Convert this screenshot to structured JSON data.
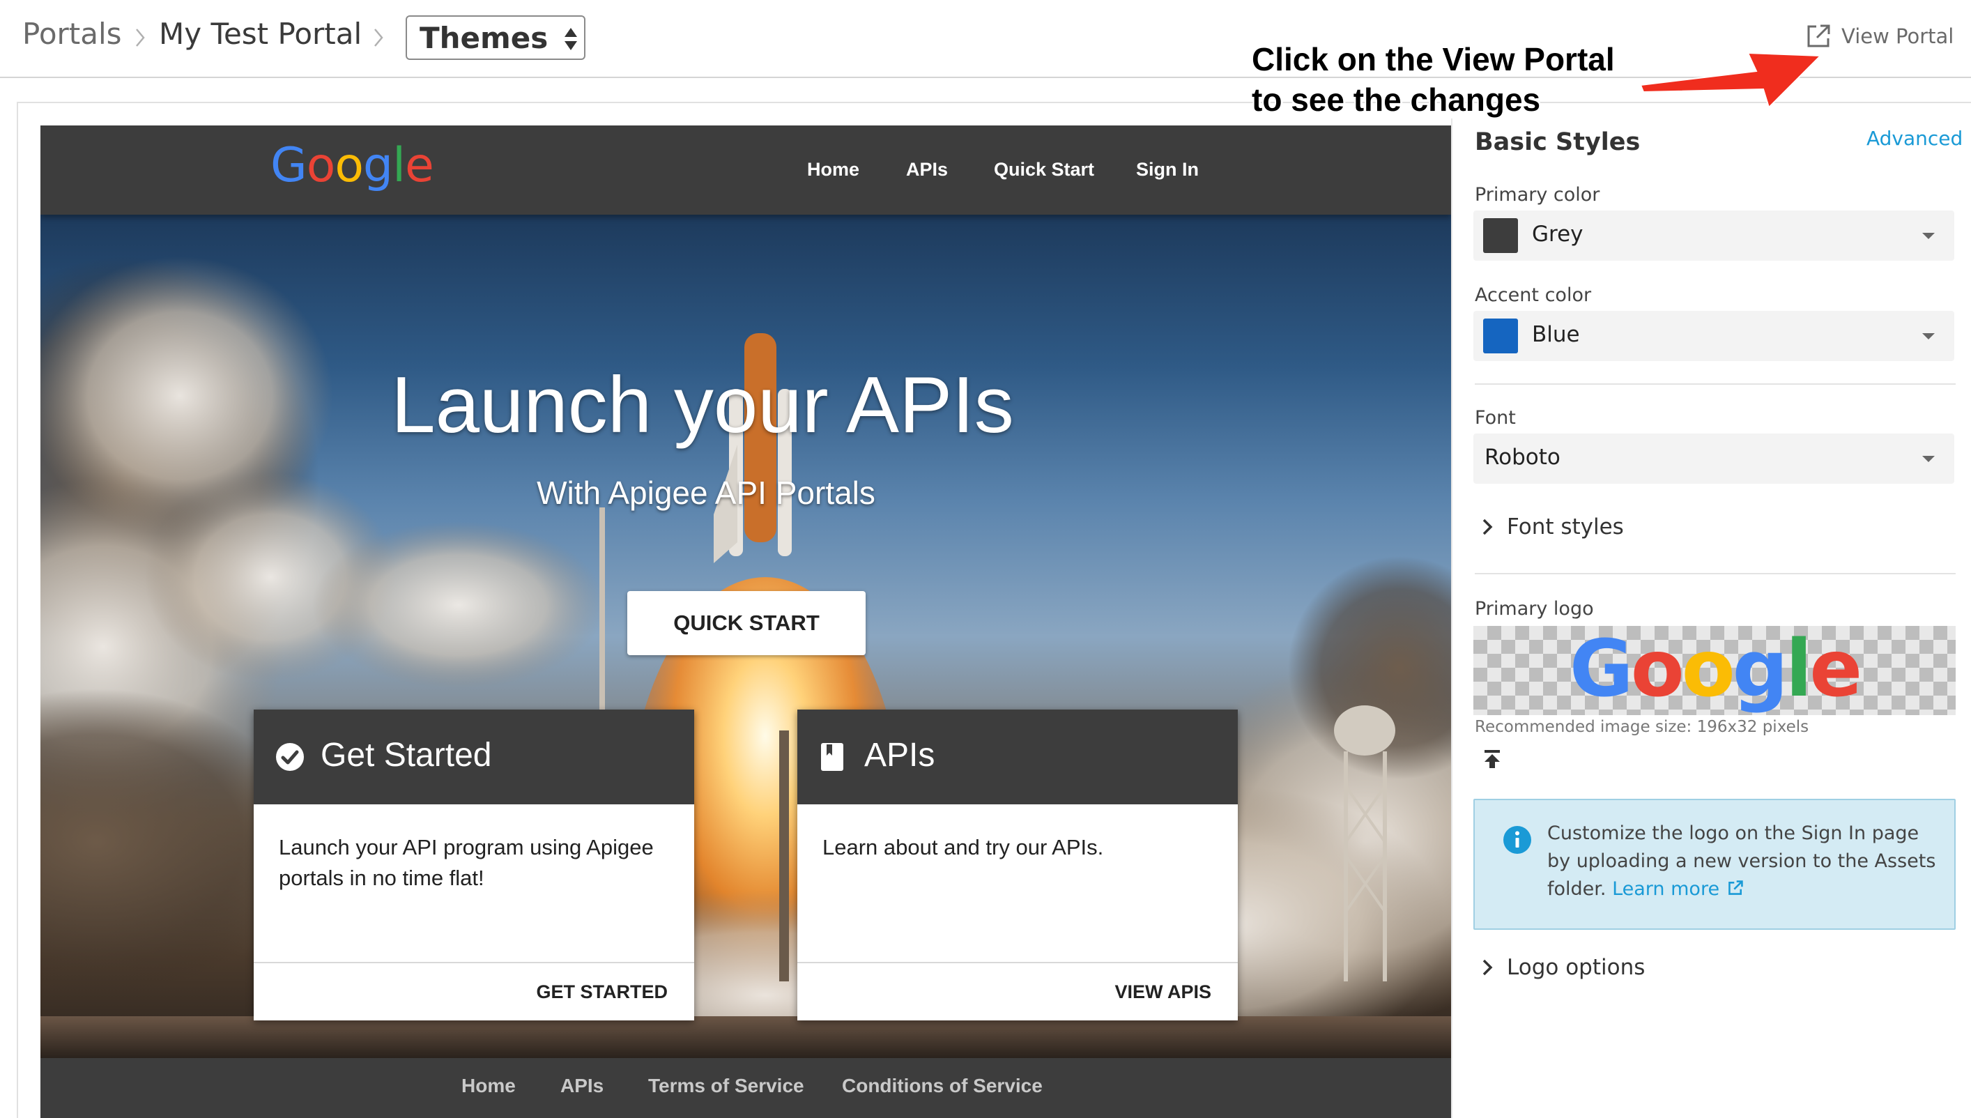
{
  "breadcrumb": {
    "root": "Portals",
    "portal": "My Test Portal",
    "section_select": "Themes"
  },
  "header_actions": {
    "view_portal": "View Portal"
  },
  "annotation": {
    "line1": "Click on the View Portal",
    "line2": "to see the changes"
  },
  "portal_preview": {
    "logo_text": "Google",
    "nav": [
      "Home",
      "APIs",
      "Quick Start",
      "Sign In"
    ],
    "hero": {
      "title": "Launch your APIs",
      "subtitle": "With Apigee API Portals",
      "button": "QUICK START"
    },
    "cards": [
      {
        "title": "Get Started",
        "icon": "check-circle-icon",
        "body": "Launch your API program using Apigee portals in no time flat!",
        "link": "GET STARTED"
      },
      {
        "title": "APIs",
        "icon": "book-icon",
        "body": "Learn about and try our APIs.",
        "link": "VIEW APIS"
      }
    ],
    "footer": [
      "Home",
      "APIs",
      "Terms of Service",
      "Conditions of Service"
    ]
  },
  "settings": {
    "title": "Basic Styles",
    "advanced_link": "Advanced",
    "primary_color": {
      "label": "Primary color",
      "value": "Grey",
      "swatch": "#3d3d3d"
    },
    "accent_color": {
      "label": "Accent color",
      "value": "Blue",
      "swatch": "#1565c0"
    },
    "font": {
      "label": "Font",
      "value": "Roboto"
    },
    "font_styles": "Font styles",
    "primary_logo": {
      "label": "Primary logo",
      "logo_text": "Google",
      "recommended": "Recommended image size: 196x32 pixels"
    },
    "info": {
      "text": "Customize the logo on the Sign In page by uploading a new version to the Assets folder.",
      "link": "Learn more"
    },
    "logo_options": "Logo options"
  },
  "colors": {
    "portal_dark": "#3d3d3d",
    "link_blue": "#1a9ad6",
    "google_blue": "#4285f4",
    "google_red": "#ea4335",
    "google_yellow": "#fbbc05",
    "google_green": "#34a853"
  }
}
